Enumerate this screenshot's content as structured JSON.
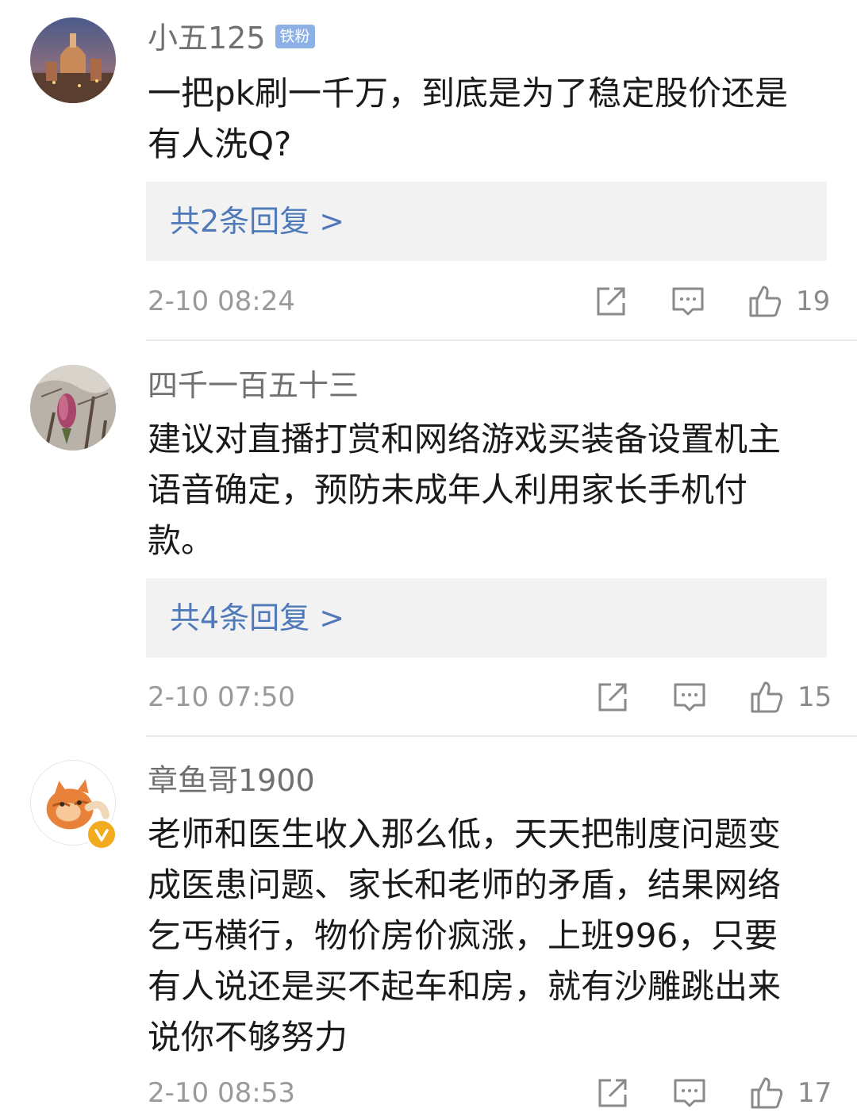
{
  "comments": [
    {
      "username": "小五125",
      "badge": "铁粉",
      "text_lines": [
        "一把pk刷一千万，到底是为了稳定股价还是",
        "有人洗Q?"
      ],
      "replies": "共2条回复 >",
      "timestamp": "2-10 08:24",
      "likes": "19"
    },
    {
      "username": "四千一百五十三",
      "text_lines": [
        "建议对直播打赏和网络游戏买装备设置机主",
        "语音确定，预防未成年人利用家长手机付",
        "款。"
      ],
      "replies": "共4条回复 >",
      "timestamp": "2-10 07:50",
      "likes": "15"
    },
    {
      "username": "章鱼哥1900",
      "text_lines": [
        "老师和医生收入那么低，天天把制度问题变",
        "成医患问题、家长和老师的矛盾，结果网络",
        "乞丐横行，物价房价疯涨，上班996，只要",
        "有人说还是买不起车和房，就有沙雕跳出来",
        "说你不够努力"
      ],
      "timestamp": "2-10 08:53",
      "likes": "17"
    }
  ],
  "icons": {
    "share": "share-icon",
    "comment": "comment-icon",
    "like": "thumbs-up-icon",
    "verified": "verified-badge-icon"
  },
  "colors": {
    "link": "#4f79b9",
    "badge": "#8db1e6",
    "verified": "#f2aa1f"
  }
}
